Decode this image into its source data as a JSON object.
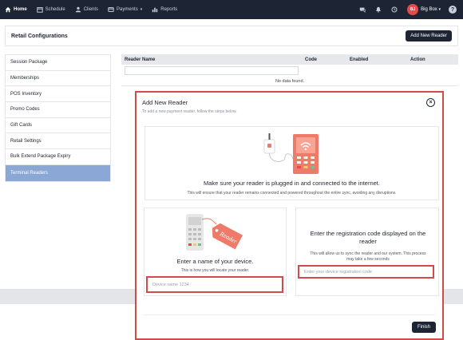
{
  "nav": {
    "items": [
      {
        "label": "Home",
        "icon": "home-icon",
        "active": true
      },
      {
        "label": "Schedule",
        "icon": "calendar-icon",
        "active": false
      },
      {
        "label": "Clients",
        "icon": "user-icon",
        "active": false
      },
      {
        "label": "Payments",
        "icon": "payment-icon",
        "active": false,
        "dropdown": true
      },
      {
        "label": "Reports",
        "icon": "bar-chart-icon",
        "active": false
      }
    ],
    "user": {
      "initials": "BJ",
      "name": "Big Box"
    },
    "help_glyph": "?"
  },
  "page": {
    "title": "Retail Configurations",
    "add_button": "Add New Reader"
  },
  "sidebar": {
    "items": [
      {
        "label": "Session Package"
      },
      {
        "label": "Memberships"
      },
      {
        "label": "POS Inventory"
      },
      {
        "label": "Promo Codes"
      },
      {
        "label": "Gift Cards"
      },
      {
        "label": "Retail Settings"
      },
      {
        "label": "Bulk Extend Package Expiry"
      },
      {
        "label": "Terminal Readers",
        "active": true
      }
    ]
  },
  "table": {
    "columns": [
      "Reader Name",
      "Code",
      "Enabled",
      "Action"
    ],
    "empty_text": "No data found."
  },
  "modal": {
    "title": "Add New Reader",
    "subtitle": "To add a new payment reader, follow the steps below.",
    "close_glyph": "×",
    "step1": {
      "title": "Make sure your reader is plugged in and connected to the internet.",
      "desc": "This will ensure that your reader remains connected and powered throughout the entire sync, avoiding any disruptions."
    },
    "step2": {
      "title": "Enter a name of your device.",
      "desc": "This is how you will locate your reader.",
      "placeholder": "Device name 1234",
      "tag_text": "Reader"
    },
    "step3": {
      "title": "Enter the registration code displayed on the reader",
      "desc": "This will allow us to sync the reader and our system. This process may take a few seconds",
      "placeholder": "Enter your device registration code"
    },
    "finish_label": "Finish"
  },
  "colors": {
    "nav_bg": "#1d2535",
    "accent_red": "#d24b4b",
    "sidebar_active": "#8aa7d6",
    "illustration_salmon": "#ef7a6a"
  }
}
